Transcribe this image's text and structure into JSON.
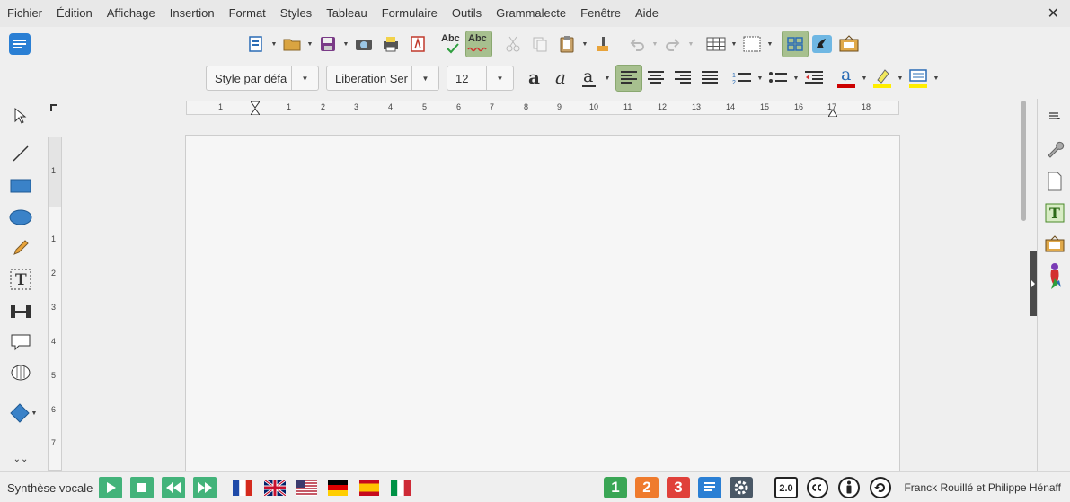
{
  "menubar": {
    "items": [
      "Fichier",
      "Édition",
      "Affichage",
      "Insertion",
      "Format",
      "Styles",
      "Tableau",
      "Formulaire",
      "Outils",
      "Grammalecte",
      "Fenêtre",
      "Aide"
    ],
    "close_glyph": "✕"
  },
  "formatting": {
    "paragraph_style": "Style par défa",
    "font_name": "Liberation Ser",
    "font_size": "12"
  },
  "toolbar": {
    "spellcheck_label": "Abc",
    "autospell_label": "Abc",
    "underline_char": "a",
    "fontcolor_char": "a"
  },
  "ruler": {
    "h_numbers": [
      "1",
      "1",
      "2",
      "3",
      "4",
      "5",
      "6",
      "7",
      "8",
      "9",
      "10",
      "11",
      "12",
      "13",
      "14",
      "15",
      "16",
      "17",
      "18"
    ],
    "v_numbers": [
      "1",
      "1",
      "2",
      "3",
      "4",
      "5",
      "6",
      "7"
    ]
  },
  "statusbar": {
    "label": "Synthèse vocale",
    "levels": [
      "1",
      "2",
      "3"
    ],
    "version_badge": "2.0",
    "credit": "Franck Rouillé et Philippe Hénaff"
  },
  "colors": {
    "active_button": "#a7c08f",
    "font_color_bar": "#cc0000",
    "highlight_bar": "#ffee00",
    "level1": "#3aa655",
    "level2": "#ef7b2d",
    "level3": "#e0403a",
    "media_green": "#43b37a"
  }
}
